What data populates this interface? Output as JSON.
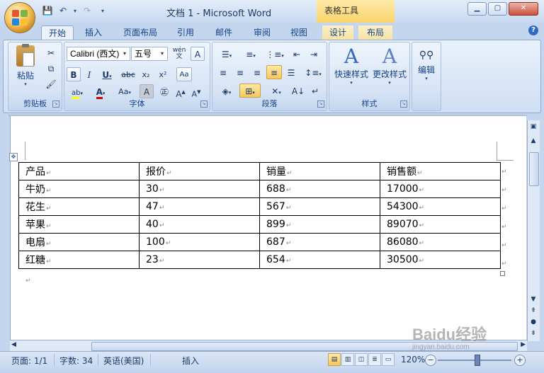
{
  "window": {
    "title": "文档 1 - Microsoft Word",
    "context_title": "表格工具"
  },
  "tabs": [
    "开始",
    "插入",
    "页面布局",
    "引用",
    "邮件",
    "审阅",
    "视图",
    "设计",
    "布局"
  ],
  "ribbon": {
    "clipboard": {
      "label": "剪贴板",
      "paste": "粘贴"
    },
    "font": {
      "label": "字体",
      "font_name": "Calibri (西文)",
      "font_size": "五号"
    },
    "paragraph": {
      "label": "段落"
    },
    "styles": {
      "label": "样式",
      "quick_styles": "快速样式",
      "change_styles": "更改样式"
    },
    "editing": {
      "label": "编辑"
    }
  },
  "table": {
    "headers": [
      "产品",
      "报价",
      "销量",
      "销售额"
    ],
    "rows": [
      [
        "牛奶",
        "30",
        "688",
        "17000"
      ],
      [
        "花生",
        "47",
        "567",
        "54300"
      ],
      [
        "苹果",
        "40",
        "899",
        "89070"
      ],
      [
        "电扇",
        "100",
        "687",
        "86080"
      ],
      [
        "红糖",
        "23",
        "654",
        "30500"
      ]
    ]
  },
  "status": {
    "page": "页面: 1/1",
    "words": "字数: 34",
    "language": "英语(美国)",
    "mode": "插入",
    "zoom": "120%"
  },
  "watermark": {
    "brand": "Baidu经验",
    "url": "jingyan.baidu.com"
  },
  "colors": {
    "ribbon_blue": "#c4d6ee",
    "context_yellow": "#f9d46b",
    "font_color_red": "#d00000",
    "highlight_yellow": "#ffff00"
  }
}
